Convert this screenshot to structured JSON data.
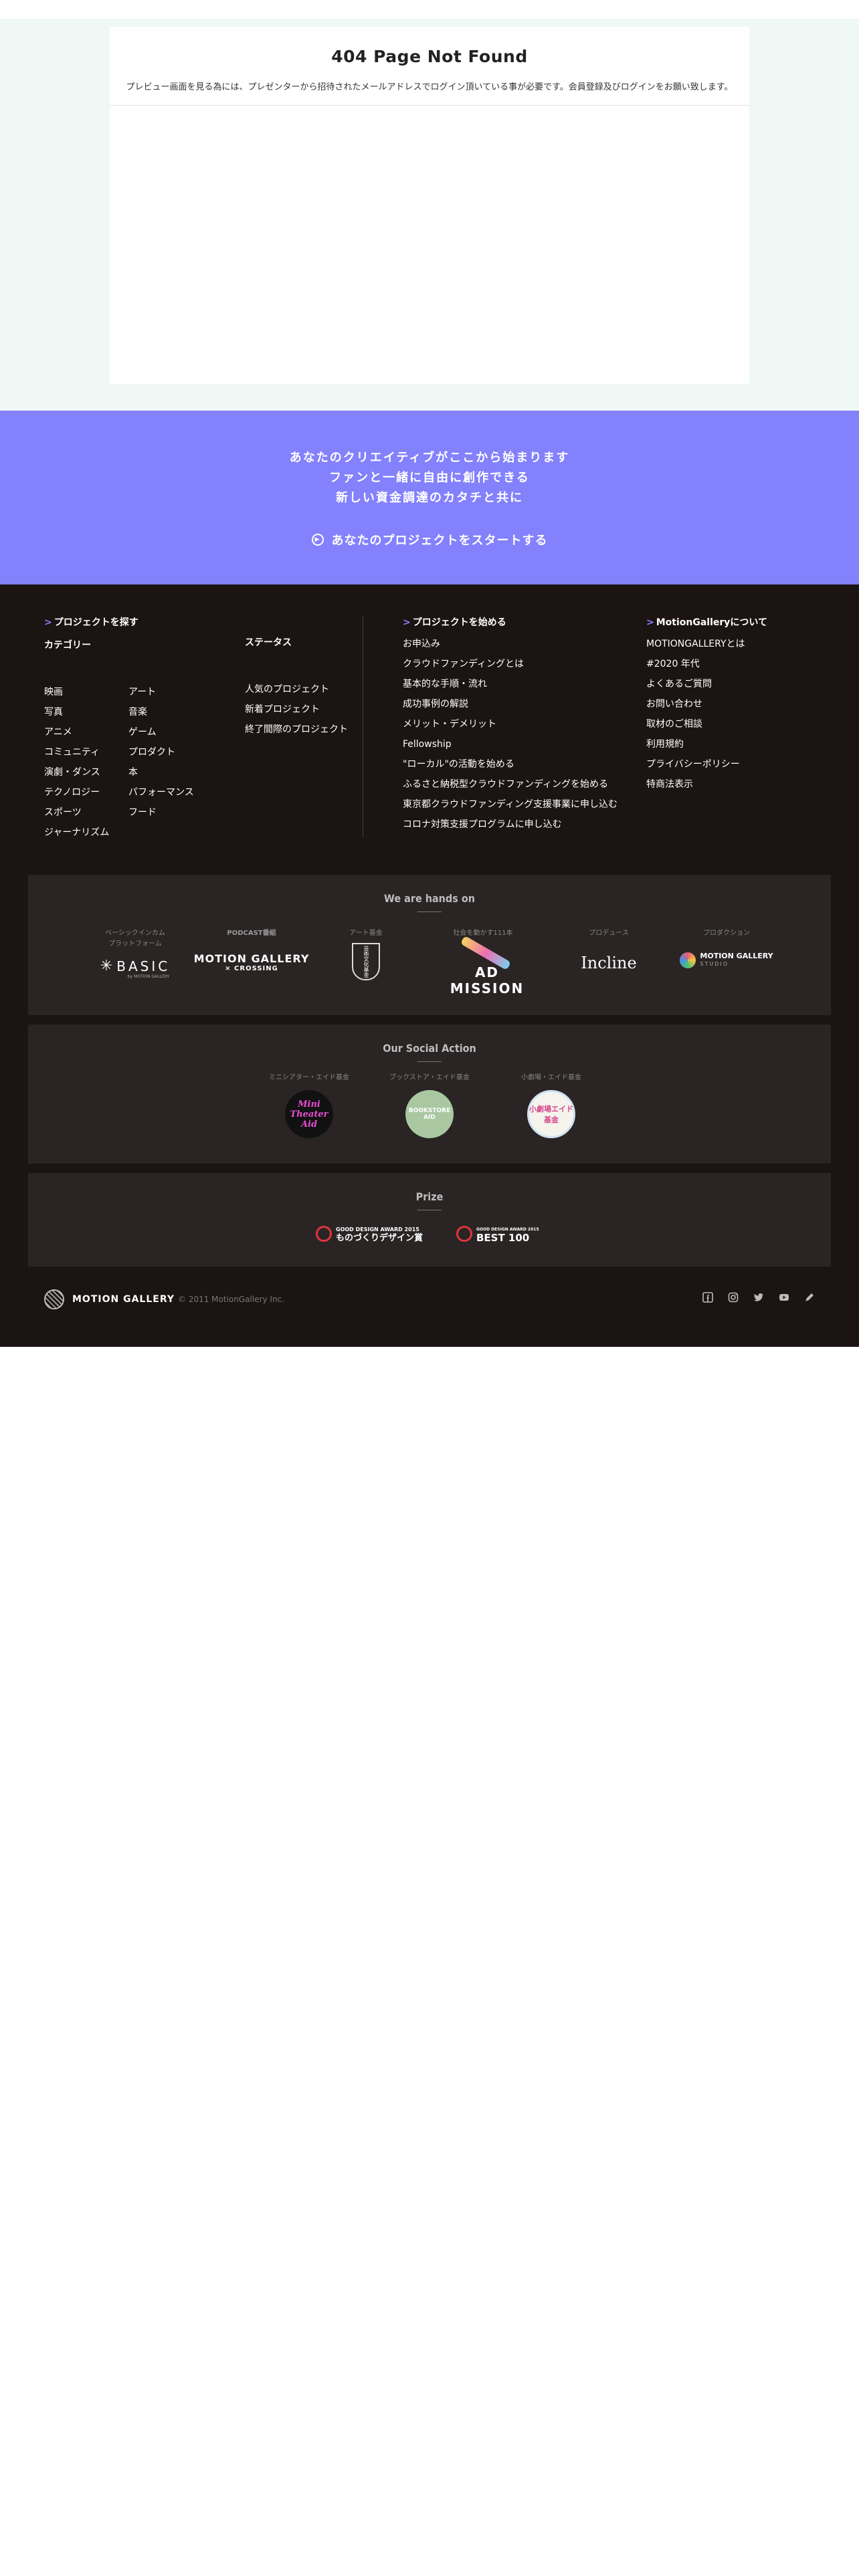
{
  "notfound": {
    "title": "404 Page Not Found",
    "message": "プレビュー画面を見る為には、プレゼンターから招待されたメールアドレスでログイン頂いている事が必要です。会員登録及びログインをお願い致します。"
  },
  "cta": {
    "line1": "あなたのクリエイティブがここから始まります",
    "line2": "ファンと一緒に自由に創作できる",
    "line3": "新しい資金調達のカタチと共に",
    "button": "あなたのプロジェクトをスタートする"
  },
  "footer": {
    "find": {
      "heading": "プロジェクトを探す",
      "category_label": "カテゴリー",
      "categories_col1": [
        "映画",
        "写真",
        "アニメ",
        "コミュニティ",
        "演劇・ダンス",
        "テクノロジー",
        "スポーツ",
        "ジャーナリズム"
      ],
      "categories_col2": [
        "アート",
        "音楽",
        "ゲーム",
        "プロダクト",
        "本",
        "パフォーマンス",
        "フード"
      ],
      "status_label": "ステータス",
      "statuses": [
        "人気のプロジェクト",
        "新着プロジェクト",
        "終了間際のプロジェクト"
      ]
    },
    "start": {
      "heading": "プロジェクトを始める",
      "items": [
        "お申込み",
        "クラウドファンディングとは",
        "基本的な手順・流れ",
        "成功事例の解説",
        "メリット・デメリット",
        "Fellowship",
        "\"ローカル\"の活動を始める",
        "ふるさと納税型クラウドファンディングを始める",
        "東京都クラウドファンディング支援事業に申し込む",
        "コロナ対策支援プログラムに申し込む"
      ]
    },
    "about": {
      "heading": "MotionGalleryについて",
      "items": [
        "MOTIONGALLERYとは",
        "#2020 年代",
        "よくあるご質問",
        "お問い合わせ",
        "取材のご相談",
        "利用規約",
        "プライバシーポリシー",
        "特商法表示"
      ]
    },
    "hands_on": {
      "title": "We are hands on",
      "logos": [
        {
          "caption": "ベーシックインカム\nプラットフォーム",
          "name": "BASIC",
          "sub": "by MOTION GALLERY"
        },
        {
          "caption": "PODCAST番組",
          "name": "MOTION GALLERY",
          "sub": "CROSSING"
        },
        {
          "caption": "アート基金",
          "name": "芸術文化基金"
        },
        {
          "caption": "社会を動かす111本",
          "name": "AD MISSION"
        },
        {
          "caption": "プロデュース",
          "name": "Incline"
        },
        {
          "caption": "プロダクション",
          "name": "MOTION GALLERY",
          "sub": "STUDIO"
        }
      ]
    },
    "social_action": {
      "title": "Our Social Action",
      "items": [
        {
          "caption": "ミニシアター・エイド基金",
          "name": "Mini Theater Aid"
        },
        {
          "caption": "ブックストア・エイド基金",
          "name": "BOOKSTORE AID"
        },
        {
          "caption": "小劇場・エイド基金",
          "name": "小劇場エイド基金"
        }
      ]
    },
    "prize": {
      "title": "Prize",
      "items": [
        {
          "top": "GOOD DESIGN AWARD 2015",
          "main": "ものづくりデザイン賞"
        },
        {
          "top": "GOOD DESIGN AWARD 2015",
          "main": "BEST 100"
        }
      ]
    },
    "brand": "MOTION GALLERY",
    "copyright": "© 2011 MotionGallery Inc."
  },
  "colors": {
    "accent": "#8381fc",
    "footer_bg": "#1c1313",
    "notfound_bg": "#f0f8f6"
  }
}
